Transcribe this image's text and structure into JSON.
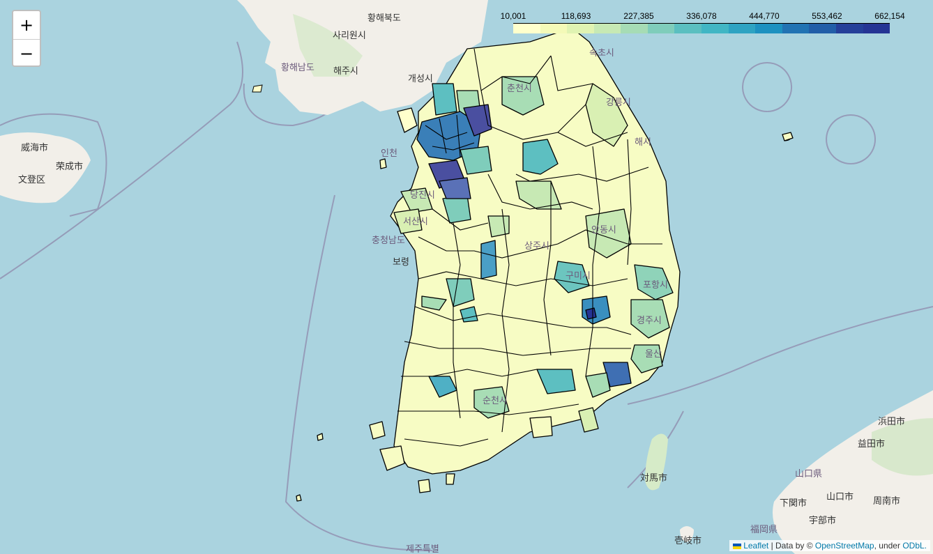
{
  "zoom": {
    "in_label": "+",
    "out_label": "−"
  },
  "legend": {
    "ticks": [
      "10,001",
      "118,693",
      "227,385",
      "336,078",
      "444,770",
      "553,462",
      "662,154"
    ],
    "colors": [
      "#ffffcc",
      "#f4fab8",
      "#e0f3b2",
      "#c7e9b4",
      "#a6dcb5",
      "#7fcdbb",
      "#5bbfc0",
      "#41b6c4",
      "#2ea3c2",
      "#1d91c0",
      "#2273b3",
      "#225ea8",
      "#253f99",
      "#253494"
    ]
  },
  "attribution": {
    "leaflet": "Leaflet",
    "data_by": "| Data by ©",
    "osm": "OpenStreetMap",
    "under": ", under",
    "odbl": "ODbL."
  },
  "labels": {
    "hwanghae_north": "황해북도",
    "sariwon": "사리원시",
    "hwanghae_south": "황해남도",
    "haeju": "해주시",
    "kaesong": "개성시",
    "incheon": "인천",
    "chuncheon": "춘천시",
    "gangneung": "강릉시",
    "sokcho": "속초시",
    "donghae": "해시",
    "weihai": "威海市",
    "rongcheng": "荣成市",
    "wendeng": "文登区",
    "chungnam": "충청남도",
    "boryeong": "보령",
    "dangjin": "당진시",
    "seosan": "서산시",
    "andong": "안동시",
    "sangju": "상주시",
    "gumi": "구미시",
    "pohang": "포항시",
    "gyeongju": "경주시",
    "ulsan": "울산",
    "suncheon": "순천시",
    "tsushima": "対馬市",
    "hamada": "浜田市",
    "masuda": "益田市",
    "yamaguchi_pref": "山口県",
    "yamaguchi": "山口市",
    "shimonoseki": "下関市",
    "ube": "宇部市",
    "shunan": "周南市",
    "fukuoka": "福岡県",
    "iki": "壱岐市",
    "jeju": "제주특별"
  }
}
